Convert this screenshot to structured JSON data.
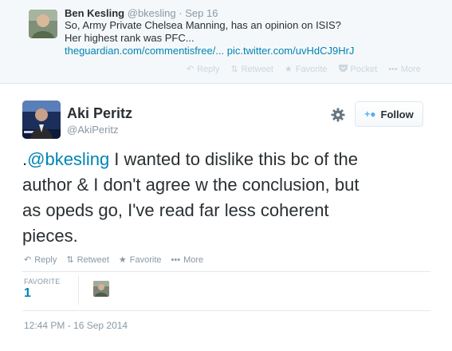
{
  "parent_tweet": {
    "name": "Ben Kesling",
    "handle": "@bkesling",
    "separator": "·",
    "date": "Sep 16",
    "text_line1": "So, Army Private Chelsea Manning, has an opinion on ISIS?",
    "text_line2": "Her highest rank was PFC...",
    "link1": "theguardian.com/commentisfree/...",
    "link2": "pic.twitter.com/uvHdCJ9HrJ",
    "actions": {
      "reply": "Reply",
      "retweet": "Retweet",
      "favorite": "Favorite",
      "pocket": "Pocket",
      "more": "More"
    }
  },
  "tweet": {
    "name": "Aki Peritz",
    "handle": "@AkiPeritz",
    "follow_label": "Follow",
    "text_prefix": ".",
    "mention": "@bkesling",
    "text_line1_rest": " I wanted to dislike this bc of the",
    "text_line2": "author & I don't agree w the conclusion, but",
    "text_line3": "as opeds go, I've read far less coherent",
    "text_line4": "pieces.",
    "actions": {
      "reply": "Reply",
      "retweet": "Retweet",
      "favorite": "Favorite",
      "more": "More"
    },
    "stats": {
      "favorite_label": "FAVORITE",
      "favorite_count": "1"
    },
    "timestamp": "12:44 PM - 16 Sep 2014"
  },
  "colors": {
    "link": "#0084b4",
    "muted": "#8899a6",
    "follow_accent": "#55acee"
  }
}
